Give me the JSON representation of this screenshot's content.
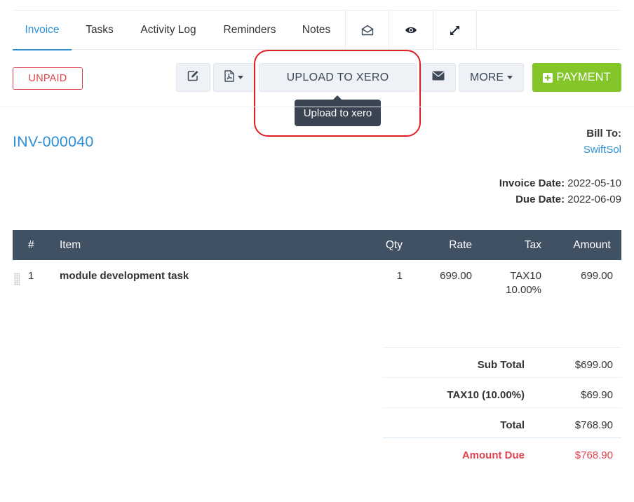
{
  "tabs": [
    {
      "label": "Invoice",
      "active": true
    },
    {
      "label": "Tasks",
      "active": false
    },
    {
      "label": "Activity Log",
      "active": false
    },
    {
      "label": "Reminders",
      "active": false
    },
    {
      "label": "Notes",
      "active": false
    }
  ],
  "tab_icons": [
    "envelope-open-icon",
    "eye-icon",
    "expand-icon"
  ],
  "toolbar": {
    "status": "UNPAID",
    "edit_icon": "edit-icon",
    "pdf_icon": "file-pdf-icon",
    "upload_label": "UPLOAD TO XERO",
    "email_icon": "envelope-icon",
    "more_label": "MORE",
    "payment_label": "PAYMENT",
    "tooltip": "Upload to xero"
  },
  "invoice": {
    "number": "INV-000040",
    "bill_to_label": "Bill To:",
    "bill_to_name": "SwiftSol",
    "date_label": "Invoice Date:",
    "date_value": "2022-05-10",
    "due_label": "Due Date:",
    "due_value": "2022-06-09"
  },
  "table": {
    "headers": {
      "num": "#",
      "item": "Item",
      "qty": "Qty",
      "rate": "Rate",
      "tax": "Tax",
      "amount": "Amount"
    },
    "rows": [
      {
        "num": "1",
        "item": "module development task",
        "qty": "1",
        "rate": "699.00",
        "tax_name": "TAX10",
        "tax_rate": "10.00%",
        "amount": "699.00"
      }
    ]
  },
  "totals": {
    "subtotal_label": "Sub Total",
    "subtotal": "$699.00",
    "tax_label": "TAX10 (10.00%)",
    "tax": "$69.90",
    "total_label": "Total",
    "total": "$768.90",
    "due_label": "Amount Due",
    "due": "$768.90"
  },
  "colors": {
    "accent": "#2d8fd5",
    "danger": "#e0434f",
    "success": "#84c529",
    "table_header": "#415164",
    "annotation": "#e11d24"
  }
}
